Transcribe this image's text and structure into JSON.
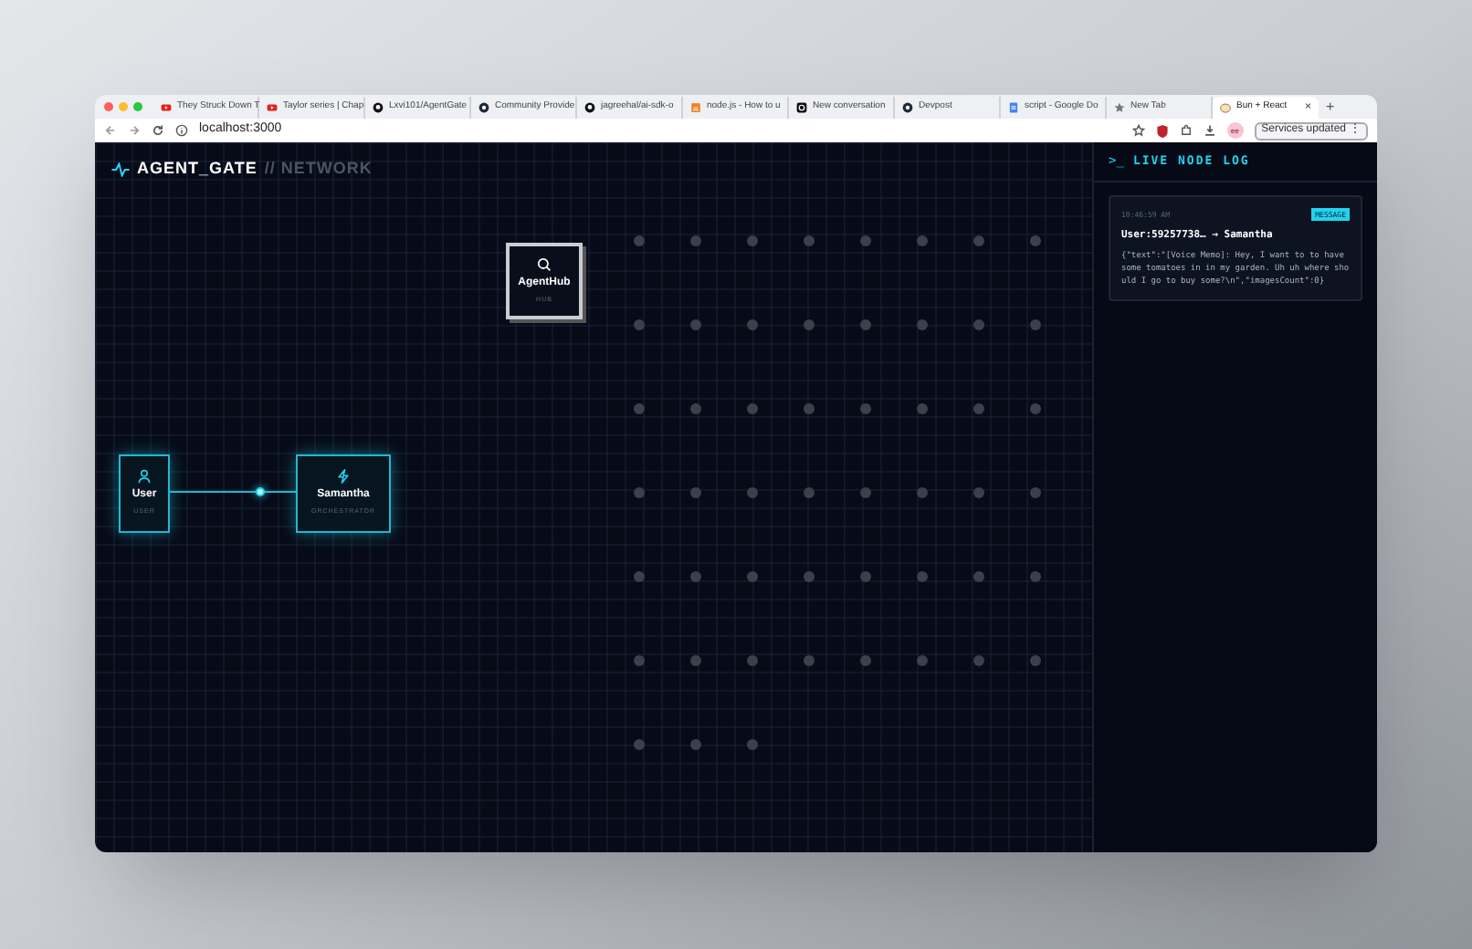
{
  "browser": {
    "tabs": [
      {
        "title": "They Struck Down T",
        "kind": "video",
        "selected": false
      },
      {
        "title": "Taylor series | Chap",
        "kind": "video",
        "selected": false
      },
      {
        "title": "Lxvi101/AgentGate",
        "kind": "github",
        "selected": false
      },
      {
        "title": "Community Provide",
        "kind": "disc",
        "selected": false
      },
      {
        "title": "jagreehal/ai-sdk-o",
        "kind": "github",
        "selected": false
      },
      {
        "title": "node.js - How to u",
        "kind": "stack",
        "selected": false
      },
      {
        "title": "New conversation",
        "kind": "chat",
        "selected": false
      },
      {
        "title": "Devpost",
        "kind": "disc",
        "selected": false
      },
      {
        "title": "script - Google Do",
        "kind": "doc",
        "selected": false
      },
      {
        "title": "New Tab",
        "kind": "star",
        "selected": false
      },
      {
        "title": "Bun + React",
        "kind": "bun",
        "selected": true
      }
    ],
    "new_tab": "+",
    "close_tab": "×",
    "address": "localhost:3000",
    "profile": "ee",
    "update_button": "Services updated",
    "menu": "⋮"
  },
  "app": {
    "brand": "AGENT_GATE",
    "section": "// NETWORK",
    "nodes": [
      {
        "name": "AgentHub",
        "role": "HUB",
        "kind": "hub",
        "active": false
      },
      {
        "name": "User",
        "role": "USER",
        "kind": "user",
        "active": true
      },
      {
        "name": "Samantha",
        "role": "ORCHESTRATOR",
        "kind": "orchestrator",
        "active": true
      }
    ],
    "log": {
      "prompt": ">_",
      "title": "LIVE NODE LOG",
      "entries": [
        {
          "time": "10:46:59 AM",
          "type": "MESSAGE",
          "route": "User:59257738… → Samantha",
          "body": "{\"text\":\"[Voice Memo]: Hey, I want to to have some tomatoes in in my garden. Uh uh where should I go to buy some?\\n\",\"imagesCount\":0}"
        }
      ]
    }
  }
}
